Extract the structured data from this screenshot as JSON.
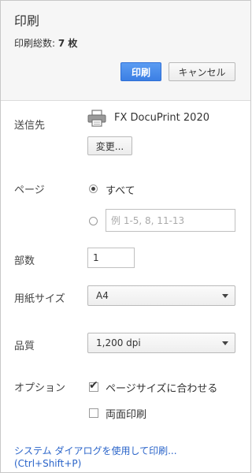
{
  "header": {
    "title": "印刷",
    "total_label": "印刷総数:",
    "total_value": "7 枚",
    "print_button": "印刷",
    "cancel_button": "キャンセル"
  },
  "destination": {
    "label": "送信先",
    "printer_name": "FX DocuPrint 2020",
    "change_button": "変更..."
  },
  "pages": {
    "label": "ページ",
    "all_label": "すべて",
    "all_selected": true,
    "range_placeholder": "例 1-5, 8, 11-13"
  },
  "copies": {
    "label": "部数",
    "value": "1"
  },
  "paper_size": {
    "label": "用紙サイズ",
    "selected": "A4"
  },
  "quality": {
    "label": "品質",
    "selected": "1,200 dpi"
  },
  "options": {
    "label": "オプション",
    "fit_to_page_label": "ページサイズに合わせる",
    "fit_to_page_checked": true,
    "duplex_label": "両面印刷",
    "duplex_checked": false
  },
  "system_dialog": {
    "link_text": "システム ダイアログを使用して印刷...",
    "shortcut": "(Ctrl+Shift+P)"
  },
  "colors": {
    "primary_button": "#3c7fe4",
    "link": "#2a64c9"
  }
}
